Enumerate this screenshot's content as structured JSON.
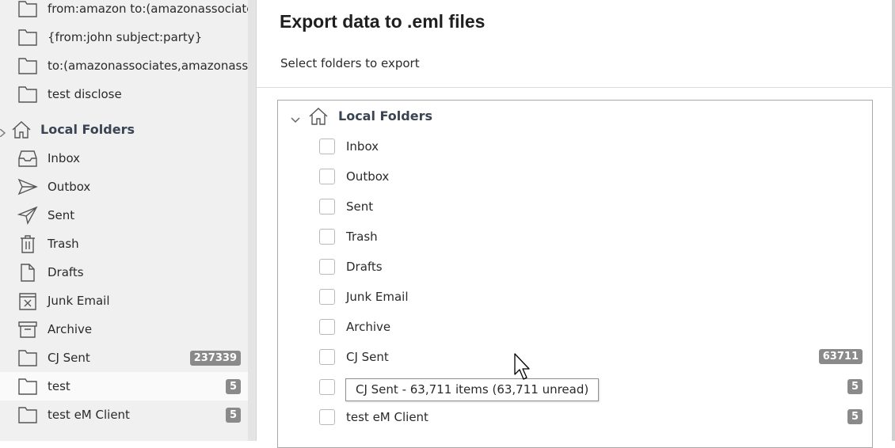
{
  "sidebar": {
    "items": [
      {
        "label": "from:amazon to:(amazonassociates,",
        "icon": "folder-icon"
      },
      {
        "label": "{from:john subject:party}",
        "icon": "folder-icon"
      },
      {
        "label": "to:(amazonassociates,amazonassoci",
        "icon": "folder-icon"
      },
      {
        "label": "test disclose",
        "icon": "folder-icon"
      }
    ],
    "local_folders_header": "Local Folders",
    "local_items": [
      {
        "label": "Inbox",
        "icon": "inbox-icon"
      },
      {
        "label": "Outbox",
        "icon": "outbox-icon"
      },
      {
        "label": "Sent",
        "icon": "sent-icon"
      },
      {
        "label": "Trash",
        "icon": "trash-icon"
      },
      {
        "label": "Drafts",
        "icon": "drafts-icon"
      },
      {
        "label": "Junk Email",
        "icon": "junk-icon"
      },
      {
        "label": "Archive",
        "icon": "archive-icon"
      },
      {
        "label": "CJ Sent",
        "icon": "folder-icon",
        "badge": "237339"
      },
      {
        "label": "test",
        "icon": "folder-icon",
        "badge": "5",
        "selected": true
      },
      {
        "label": "test eM Client",
        "icon": "folder-icon",
        "badge": "5"
      }
    ]
  },
  "dialog": {
    "title": "Export data to .eml files",
    "subtitle": "Select folders to export",
    "tree": {
      "root_label": "Local Folders",
      "items": [
        {
          "label": "Inbox"
        },
        {
          "label": "Outbox"
        },
        {
          "label": "Sent"
        },
        {
          "label": "Trash"
        },
        {
          "label": "Drafts"
        },
        {
          "label": "Junk Email"
        },
        {
          "label": "Archive"
        },
        {
          "label": "CJ Sent",
          "badge": "63711"
        },
        {
          "label": "",
          "badge": "5"
        },
        {
          "label": "test eM Client",
          "badge": "5"
        }
      ]
    },
    "tooltip": "CJ Sent - 63,711 items (63,711 unread)"
  },
  "colors": {
    "sidebar_bg": "#f0f0f0",
    "badge_bg": "#8a8a8a",
    "header_text": "#3a4452"
  }
}
